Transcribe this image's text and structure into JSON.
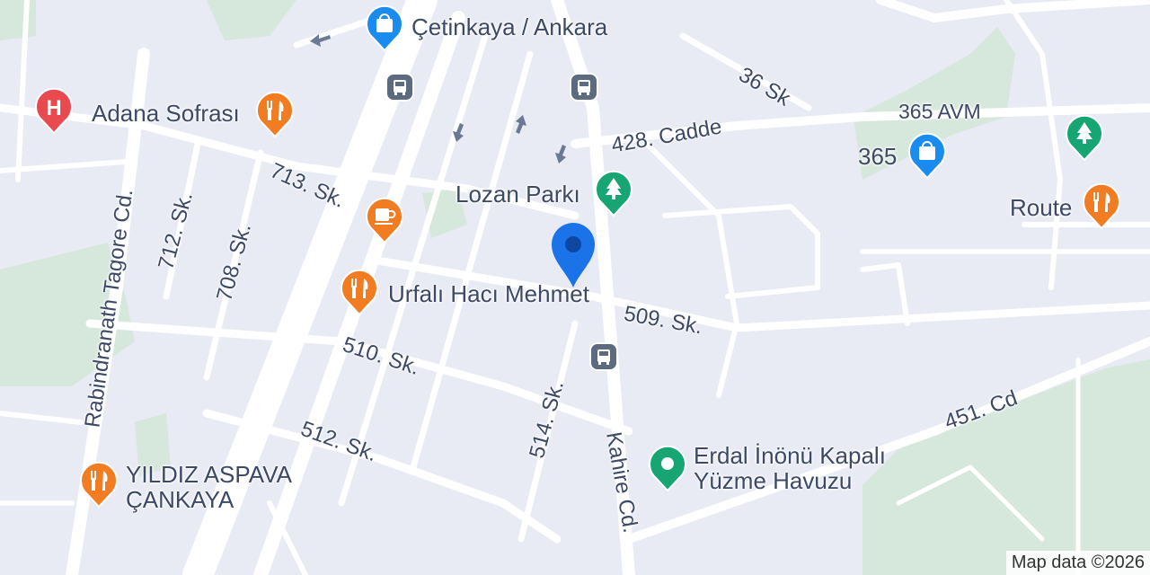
{
  "streets": {
    "rabindranath": "Rabindranath Tagore Cd.",
    "s712": "712. Sk.",
    "s708": "708. Sk.",
    "s713": "713. Sk.",
    "s510": "510. Sk.",
    "s512": "512. Sk.",
    "s514": "514. Sk.",
    "kahire": "Kahire Cd.",
    "s509": "509. Sk.",
    "cadde428": "428. Cadde",
    "s36": "36 Sk",
    "cd451": "451. Cd"
  },
  "places": {
    "cetinkaya": "Çetinkaya / Ankara",
    "adana": "Adana Sofrası",
    "lozan": "Lozan Parkı",
    "urfali": "Urfalı Hacı Mehmet",
    "avm365_top": "365 AVM",
    "avm365": "365",
    "route": "Route",
    "erdal_line1": "Erdal İnönü Kapalı",
    "erdal_line2": "Yüzme Havuzu",
    "yildiz_line1": "YILDIZ ASPAVA",
    "yildiz_line2": "ÇANKAYA"
  },
  "icons": [
    "hospital-icon",
    "restaurant-icon",
    "shopping-bag-icon",
    "park-tree-icon",
    "cafe-cup-icon",
    "bus-stop-icon",
    "location-pin-icon",
    "one-way-arrow-icon"
  ],
  "colors": {
    "background": "#e8eaf4",
    "road": "#ffffff",
    "park": "#d6e7dc",
    "restaurant": "#f17c22",
    "shopping": "#1a8cf0",
    "park_pin": "#17a673",
    "hospital": "#e94a4f",
    "bus": "#5c6b80",
    "user_pin": "#1a73e8"
  },
  "attribution": "Map data ©2026"
}
